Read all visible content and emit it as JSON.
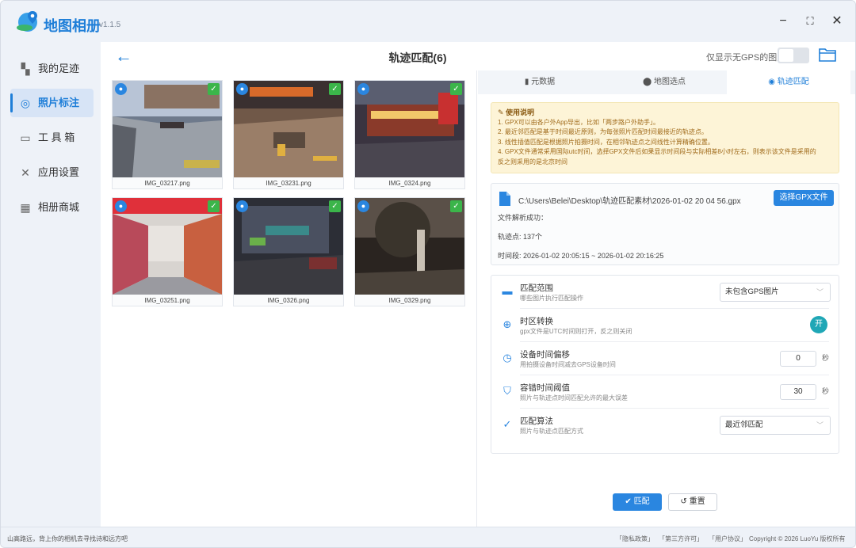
{
  "app": {
    "name": "地图相册",
    "version": "v1.1.5"
  },
  "window_controls": {
    "minimize": "−",
    "maximize": "⛶",
    "close": "✕"
  },
  "sidebar": {
    "items": [
      {
        "label": "我的足迹",
        "icon": "footprint-icon"
      },
      {
        "label": "照片标注",
        "icon": "target-icon",
        "active": true
      },
      {
        "label": "工 具 箱",
        "icon": "toolbox-icon"
      },
      {
        "label": "应用设置",
        "icon": "tools-icon"
      },
      {
        "label": "相册商城",
        "icon": "store-icon"
      }
    ],
    "collapse": "◀"
  },
  "header": {
    "title": "轨迹匹配(6)",
    "gps_only_label": "仅显示无GPS的图片:"
  },
  "photos": [
    {
      "name": "IMG_03217.png"
    },
    {
      "name": "IMG_03231.png"
    },
    {
      "name": "IMG_0324.png"
    },
    {
      "name": "IMG_03251.png"
    },
    {
      "name": "IMG_0326.png"
    },
    {
      "name": "IMG_0329.png"
    }
  ],
  "tabs": [
    {
      "label": "元数据"
    },
    {
      "label": "地图选点"
    },
    {
      "label": "轨迹匹配",
      "active": true
    }
  ],
  "notice": {
    "title": "使用说明",
    "lines": [
      "1. GPX可以由各户外App导出，比如「两步路户外助手」。",
      "2. 最近邻匹配是基于时间最近原则，为每张照片匹配时间最接近的轨迹点。",
      "3. 线性插值匹配是根据照片拍摄时间，在相邻轨迹点之间线性计算精确位置。",
      "4. GPX文件通常采用国际utc时间，选择GPX文件后如果显示时间段与实际相差8小时左右，则表示该文件是采用的",
      "反之则采用的是北京时间"
    ]
  },
  "file": {
    "path": "C:\\Users\\Belei\\Desktop\\轨迹匹配素材\\2026-01-02 20 04 56.gpx",
    "select_button": "选择GPX文件",
    "parse_status": "文件解析成功：",
    "points": "轨迹点: 137个",
    "period": "时间段: 2026-01-02 20:05:15 ~ 2026-01-02 20:16:25"
  },
  "settings": [
    {
      "title": "匹配范围",
      "desc": "哪些图片执行匹配操作",
      "value": "未包含GPS图片",
      "icon": "range-icon"
    },
    {
      "title": "时区转换",
      "desc": "gpx文件是UTC时间则打开，反之则关闭",
      "value": "开",
      "icon": "globe-icon"
    },
    {
      "title": "设备时间偏移",
      "desc": "用拍摄设备时间减去GPS设备时间",
      "value": "0",
      "unit": "秒",
      "icon": "clock-icon"
    },
    {
      "title": "容错时间阈值",
      "desc": "照片与轨迹点时间匹配允许的最大误差",
      "value": "30",
      "unit": "秒",
      "icon": "shield-icon"
    },
    {
      "title": "匹配算法",
      "desc": "照片与轨迹点匹配方式",
      "value": "最近邻匹配",
      "icon": "check-icon"
    }
  ],
  "actions": {
    "match": "匹配",
    "reset": "重置"
  },
  "status": {
    "slogan": "山高路远，背上你的相机去寻找诗和远方吧",
    "links": [
      "「隐私政策」",
      "「第三方许可」",
      "「用户协议」"
    ],
    "copyright": "Copyright © 2026 LuoYu 版权所有"
  }
}
